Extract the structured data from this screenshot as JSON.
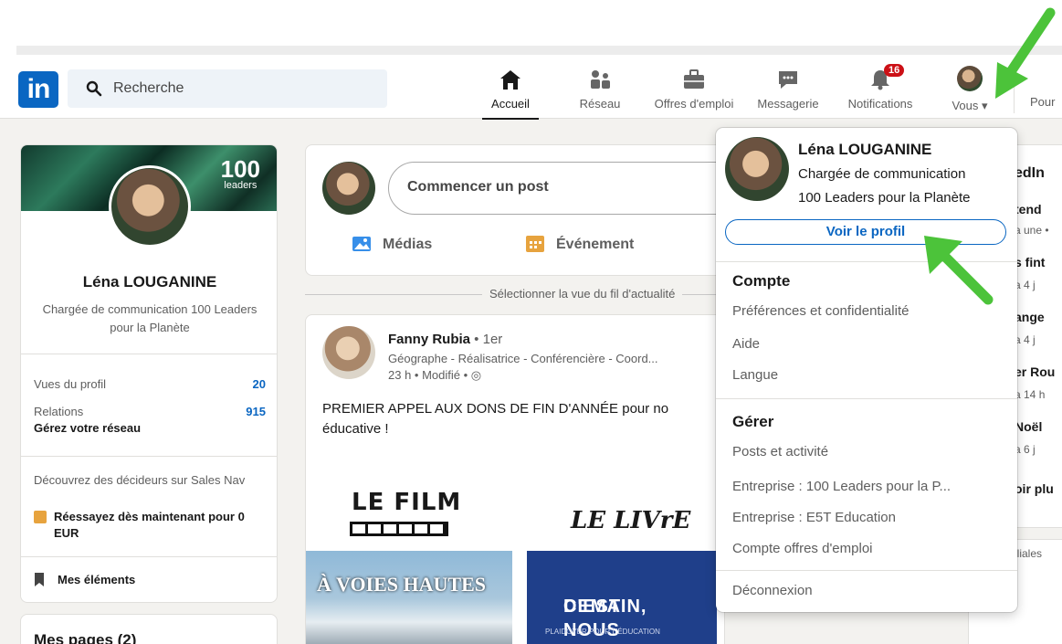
{
  "nav": {
    "logo": "in",
    "search_placeholder": "Recherche",
    "items": [
      {
        "label": "Accueil",
        "icon": "home-icon"
      },
      {
        "label": "Réseau",
        "icon": "network-icon"
      },
      {
        "label": "Offres d'emploi",
        "icon": "jobs-icon"
      },
      {
        "label": "Messagerie",
        "icon": "messaging-icon"
      },
      {
        "label": "Notifications",
        "icon": "bell-icon",
        "badge": "16"
      },
      {
        "label": "Vous",
        "icon": "avatar"
      }
    ],
    "right_cut": "Pour"
  },
  "profile": {
    "banner_logo": "100",
    "banner_logo_sub": "leaders",
    "name": "Léna LOUGANINE",
    "title": "Chargée de communication 100 Leaders pour la Planète",
    "stats": [
      {
        "label": "Vues du profil",
        "value": "20"
      },
      {
        "label": "Relations",
        "value": "915"
      }
    ],
    "manage": "Gérez votre réseau",
    "promo": "Découvrez des décideurs sur Sales Nav",
    "promo_cta": "Réessayez dès maintenant pour 0 EUR",
    "saved": "Mes éléments",
    "pages": "Mes pages (2)"
  },
  "composer": {
    "placeholder": "Commencer un post",
    "actions": [
      "Médias",
      "Événement"
    ]
  },
  "feed_sort": "Sélectionner la vue du fil d'actualité",
  "post": {
    "author": "Fanny Rubia",
    "degree": " • 1er",
    "headline": "Géographe - Réalisatrice - Conférencière - Coord...",
    "time": "23 h • Modifié • ",
    "text": "PREMIER APPEL AUX DONS DE FIN D'ANNÉE pour no éducative !",
    "media": {
      "film": "LE FILM",
      "livre": "LE LIVrE",
      "book1": "À VOIES HAUTES",
      "book2_line1": "DEMAIN,",
      "book2_line2": "C'EST NOUS",
      "book2_small": "PLAIDOYER POUR L'ÉDUCATION"
    }
  },
  "right_rail": {
    "heading": "edIn",
    "items": [
      {
        "title": "tend",
        "sub": "a une •"
      },
      {
        "title": "s fint",
        "sub": "a 4 j"
      },
      {
        "title": "ange",
        "sub": "a 4 j"
      },
      {
        "title": "er Rou",
        "sub": "a 14 h"
      },
      {
        "title": "Noël",
        "sub": "a 6 j"
      },
      {
        "title": "oir plu",
        "sub": ""
      }
    ],
    "bottom": "iliales"
  },
  "menu": {
    "name": "Léna LOUGANINE",
    "line1": "Chargée de communication",
    "line2": "100 Leaders pour la Planète",
    "view_profile": "Voir le profil",
    "section_account": "Compte",
    "account_items": [
      "Préférences et confidentialité",
      "Aide",
      "Langue"
    ],
    "section_manage": "Gérer",
    "manage_items": [
      "Posts et activité",
      "Entreprise : 100 Leaders pour la P...",
      "Entreprise : E5T Education",
      "Compte offres d'emploi"
    ],
    "signout": "Déconnexion"
  },
  "colors": {
    "accent": "#0a66c2",
    "badge": "#cc1016",
    "arrow": "#4cc33a"
  }
}
